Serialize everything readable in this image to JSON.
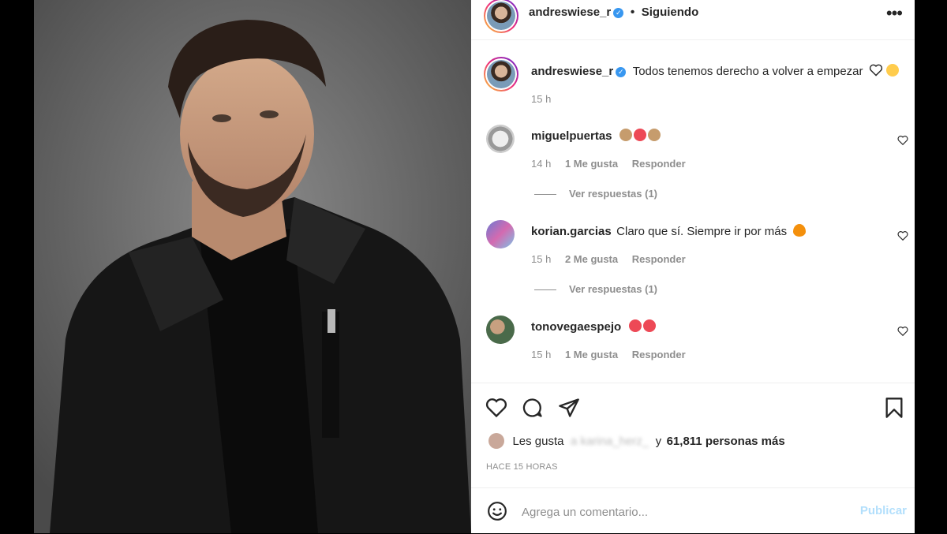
{
  "post": {
    "username": "andreswiese_r",
    "follow_status": "Siguiendo",
    "more_icon": "ellipsis-icon"
  },
  "caption": {
    "username": "andreswiese_r",
    "text": "Todos tenemos derecho a volver a empezar",
    "time": "15 h"
  },
  "comments": [
    {
      "username": "miguelpuertas",
      "text": "",
      "time": "14 h",
      "likes": "1 Me gusta",
      "reply": "Responder",
      "view_replies": "Ver respuestas (1)"
    },
    {
      "username": "korian.garcias",
      "text": "Claro que sí. Siempre ir por más",
      "time": "15 h",
      "likes": "2 Me gusta",
      "reply": "Responder",
      "view_replies": "Ver respuestas (1)"
    },
    {
      "username": "tonovegaespejo",
      "text": "",
      "time": "15 h",
      "likes": "1 Me gusta",
      "reply": "Responder"
    }
  ],
  "likes": {
    "prefix": "Les gusta",
    "connector": "y",
    "count_text": "61,811 personas más",
    "blurred_name": "a karina_herz_"
  },
  "timestamp": "HACE 15 HORAS",
  "composer": {
    "placeholder": "Agrega un comentario...",
    "publish": "Publicar"
  },
  "colors": {
    "accent": "#3897f0",
    "publish_disabled": "#b2dffc",
    "heart_red": "#ed4956"
  }
}
